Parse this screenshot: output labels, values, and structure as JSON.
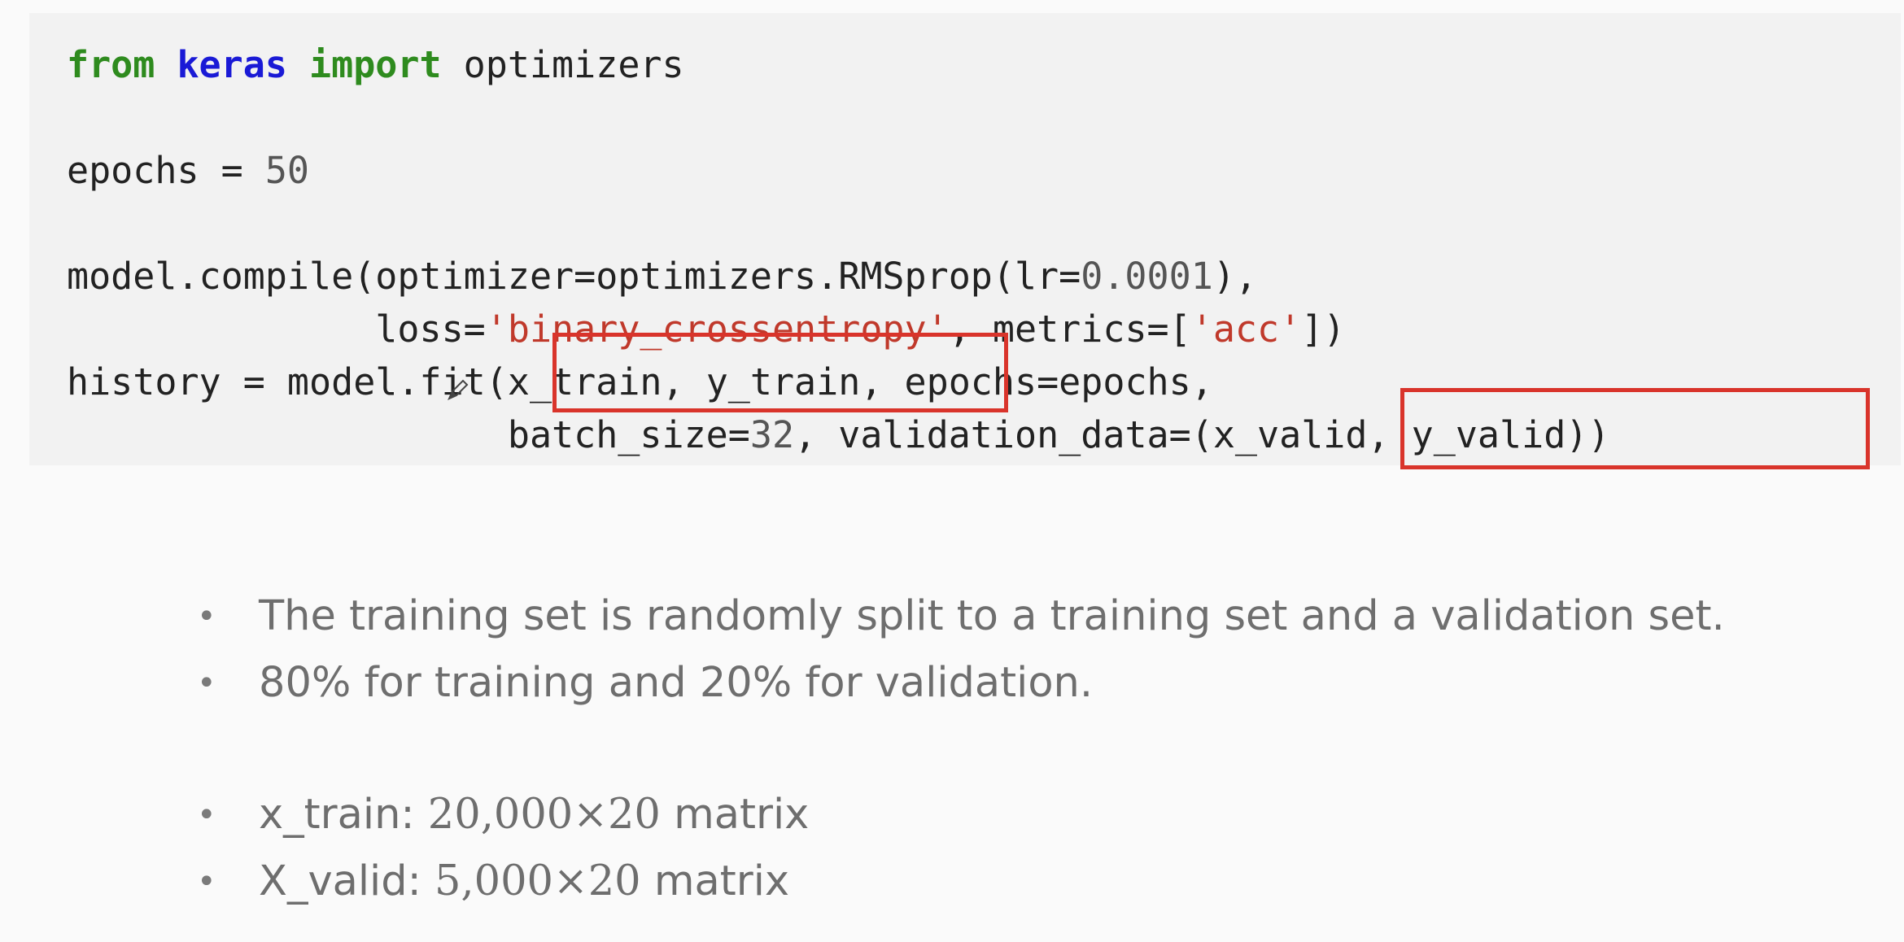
{
  "code": {
    "line1": {
      "kw_from": "from",
      "module": "keras",
      "kw_import": "import",
      "rest": " optimizers"
    },
    "line2": {
      "name": "epochs = ",
      "value": "50"
    },
    "line3": {
      "prefix": "model.compile(optimizer=optimizers.RMSprop(lr=",
      "value": "0.0001",
      "suffix": "),"
    },
    "line4": {
      "prefix": "              loss=",
      "loss_str": "'binary_crossentropy'",
      "mid": ", metrics=[",
      "metric_str": "'acc'",
      "suffix": "])"
    },
    "line5": {
      "prefix": "history = model.fit(",
      "args": "x_train, y_train",
      "suffix": ", epochs=epochs,"
    },
    "line6": {
      "prefix": "                    batch_size=",
      "value": "32",
      "mid": ", validation_data=(",
      "args": "x_valid, y_valid",
      "suffix": "))"
    }
  },
  "bullets": [
    {
      "text": "The training set is randomly split to a training set and a validation set."
    },
    {
      "text": "80% for training and 20% for validation."
    },
    {
      "label": "x_train: ",
      "math": "20,000×20",
      "tail": " matrix"
    },
    {
      "label": "X_valid: ",
      "math": "5,000×20",
      "tail": " matrix"
    }
  ],
  "bullet_char": "•",
  "colors": {
    "keyword": "#2e8b1e",
    "module": "#1a1ad6",
    "string": "#c0392b",
    "highlight_box": "#d9342b",
    "bullet_text": "#6e6e6e"
  }
}
